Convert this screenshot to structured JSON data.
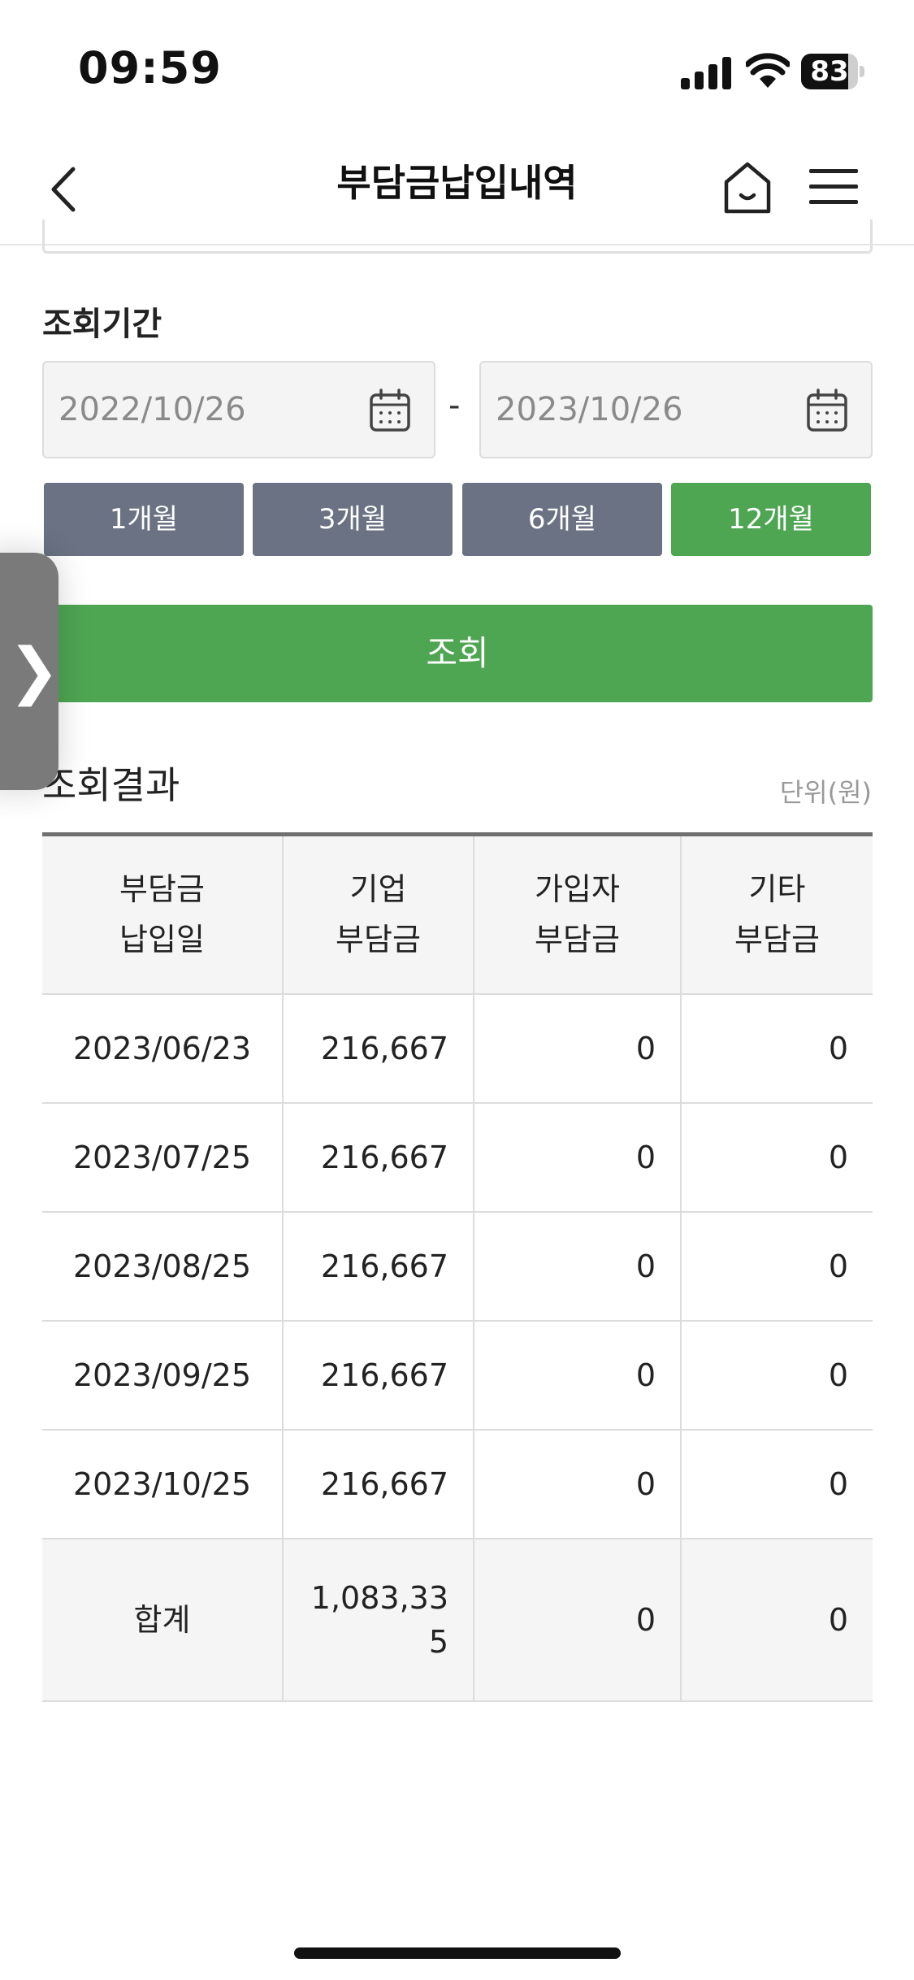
{
  "status_bar": {
    "time": "09:59",
    "battery": "83",
    "battery_level": 0.83
  },
  "header": {
    "title": "부담금납입내역"
  },
  "search": {
    "period_label": "조회기간",
    "start_date": "2022/10/26",
    "end_date": "2023/10/26",
    "separator": "-",
    "period_options": [
      "1개월",
      "3개월",
      "6개월",
      "12개월"
    ],
    "selected_period": "12개월",
    "search_button": "조회"
  },
  "results": {
    "label": "조회결과",
    "unit": "단위(원)",
    "headers": [
      [
        "부담금",
        "납입일"
      ],
      [
        "기업",
        "부담금"
      ],
      [
        "가입자",
        "부담금"
      ],
      [
        "기타",
        "부담금"
      ]
    ],
    "rows": [
      [
        "2023/06/23",
        "216,667",
        "0",
        "0"
      ],
      [
        "2023/07/25",
        "216,667",
        "0",
        "0"
      ],
      [
        "2023/08/25",
        "216,667",
        "0",
        "0"
      ],
      [
        "2023/09/25",
        "216,667",
        "0",
        "0"
      ],
      [
        "2023/10/25",
        "216,667",
        "0",
        "0"
      ]
    ],
    "total": [
      "합계",
      "1,083,33",
      "5",
      "0",
      "0"
    ]
  },
  "side_handle": {
    "glyph": "❯"
  },
  "colors": {
    "accent": "#4ea552",
    "period_button": "#6a7283"
  }
}
